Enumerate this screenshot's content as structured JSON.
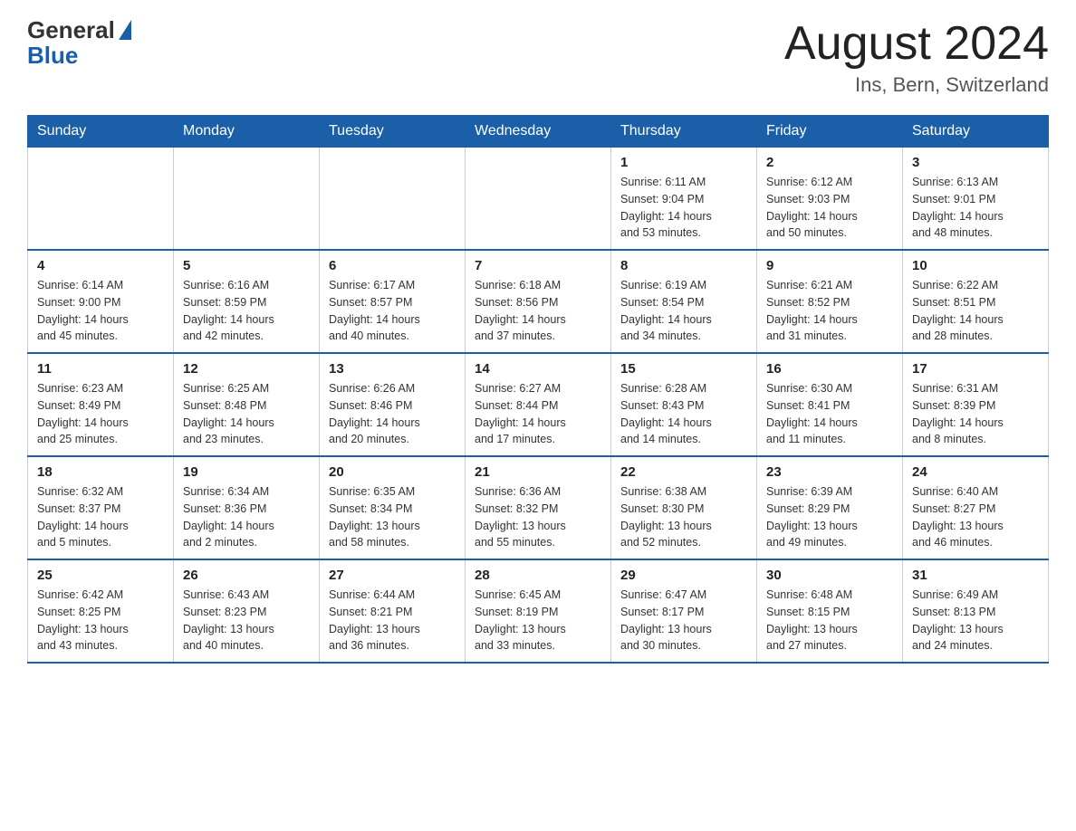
{
  "logo": {
    "general": "General",
    "blue": "Blue"
  },
  "header": {
    "month": "August 2024",
    "location": "Ins, Bern, Switzerland"
  },
  "days_of_week": [
    "Sunday",
    "Monday",
    "Tuesday",
    "Wednesday",
    "Thursday",
    "Friday",
    "Saturday"
  ],
  "weeks": [
    [
      {
        "day": "",
        "info": ""
      },
      {
        "day": "",
        "info": ""
      },
      {
        "day": "",
        "info": ""
      },
      {
        "day": "",
        "info": ""
      },
      {
        "day": "1",
        "info": "Sunrise: 6:11 AM\nSunset: 9:04 PM\nDaylight: 14 hours\nand 53 minutes."
      },
      {
        "day": "2",
        "info": "Sunrise: 6:12 AM\nSunset: 9:03 PM\nDaylight: 14 hours\nand 50 minutes."
      },
      {
        "day": "3",
        "info": "Sunrise: 6:13 AM\nSunset: 9:01 PM\nDaylight: 14 hours\nand 48 minutes."
      }
    ],
    [
      {
        "day": "4",
        "info": "Sunrise: 6:14 AM\nSunset: 9:00 PM\nDaylight: 14 hours\nand 45 minutes."
      },
      {
        "day": "5",
        "info": "Sunrise: 6:16 AM\nSunset: 8:59 PM\nDaylight: 14 hours\nand 42 minutes."
      },
      {
        "day": "6",
        "info": "Sunrise: 6:17 AM\nSunset: 8:57 PM\nDaylight: 14 hours\nand 40 minutes."
      },
      {
        "day": "7",
        "info": "Sunrise: 6:18 AM\nSunset: 8:56 PM\nDaylight: 14 hours\nand 37 minutes."
      },
      {
        "day": "8",
        "info": "Sunrise: 6:19 AM\nSunset: 8:54 PM\nDaylight: 14 hours\nand 34 minutes."
      },
      {
        "day": "9",
        "info": "Sunrise: 6:21 AM\nSunset: 8:52 PM\nDaylight: 14 hours\nand 31 minutes."
      },
      {
        "day": "10",
        "info": "Sunrise: 6:22 AM\nSunset: 8:51 PM\nDaylight: 14 hours\nand 28 minutes."
      }
    ],
    [
      {
        "day": "11",
        "info": "Sunrise: 6:23 AM\nSunset: 8:49 PM\nDaylight: 14 hours\nand 25 minutes."
      },
      {
        "day": "12",
        "info": "Sunrise: 6:25 AM\nSunset: 8:48 PM\nDaylight: 14 hours\nand 23 minutes."
      },
      {
        "day": "13",
        "info": "Sunrise: 6:26 AM\nSunset: 8:46 PM\nDaylight: 14 hours\nand 20 minutes."
      },
      {
        "day": "14",
        "info": "Sunrise: 6:27 AM\nSunset: 8:44 PM\nDaylight: 14 hours\nand 17 minutes."
      },
      {
        "day": "15",
        "info": "Sunrise: 6:28 AM\nSunset: 8:43 PM\nDaylight: 14 hours\nand 14 minutes."
      },
      {
        "day": "16",
        "info": "Sunrise: 6:30 AM\nSunset: 8:41 PM\nDaylight: 14 hours\nand 11 minutes."
      },
      {
        "day": "17",
        "info": "Sunrise: 6:31 AM\nSunset: 8:39 PM\nDaylight: 14 hours\nand 8 minutes."
      }
    ],
    [
      {
        "day": "18",
        "info": "Sunrise: 6:32 AM\nSunset: 8:37 PM\nDaylight: 14 hours\nand 5 minutes."
      },
      {
        "day": "19",
        "info": "Sunrise: 6:34 AM\nSunset: 8:36 PM\nDaylight: 14 hours\nand 2 minutes."
      },
      {
        "day": "20",
        "info": "Sunrise: 6:35 AM\nSunset: 8:34 PM\nDaylight: 13 hours\nand 58 minutes."
      },
      {
        "day": "21",
        "info": "Sunrise: 6:36 AM\nSunset: 8:32 PM\nDaylight: 13 hours\nand 55 minutes."
      },
      {
        "day": "22",
        "info": "Sunrise: 6:38 AM\nSunset: 8:30 PM\nDaylight: 13 hours\nand 52 minutes."
      },
      {
        "day": "23",
        "info": "Sunrise: 6:39 AM\nSunset: 8:29 PM\nDaylight: 13 hours\nand 49 minutes."
      },
      {
        "day": "24",
        "info": "Sunrise: 6:40 AM\nSunset: 8:27 PM\nDaylight: 13 hours\nand 46 minutes."
      }
    ],
    [
      {
        "day": "25",
        "info": "Sunrise: 6:42 AM\nSunset: 8:25 PM\nDaylight: 13 hours\nand 43 minutes."
      },
      {
        "day": "26",
        "info": "Sunrise: 6:43 AM\nSunset: 8:23 PM\nDaylight: 13 hours\nand 40 minutes."
      },
      {
        "day": "27",
        "info": "Sunrise: 6:44 AM\nSunset: 8:21 PM\nDaylight: 13 hours\nand 36 minutes."
      },
      {
        "day": "28",
        "info": "Sunrise: 6:45 AM\nSunset: 8:19 PM\nDaylight: 13 hours\nand 33 minutes."
      },
      {
        "day": "29",
        "info": "Sunrise: 6:47 AM\nSunset: 8:17 PM\nDaylight: 13 hours\nand 30 minutes."
      },
      {
        "day": "30",
        "info": "Sunrise: 6:48 AM\nSunset: 8:15 PM\nDaylight: 13 hours\nand 27 minutes."
      },
      {
        "day": "31",
        "info": "Sunrise: 6:49 AM\nSunset: 8:13 PM\nDaylight: 13 hours\nand 24 minutes."
      }
    ]
  ]
}
